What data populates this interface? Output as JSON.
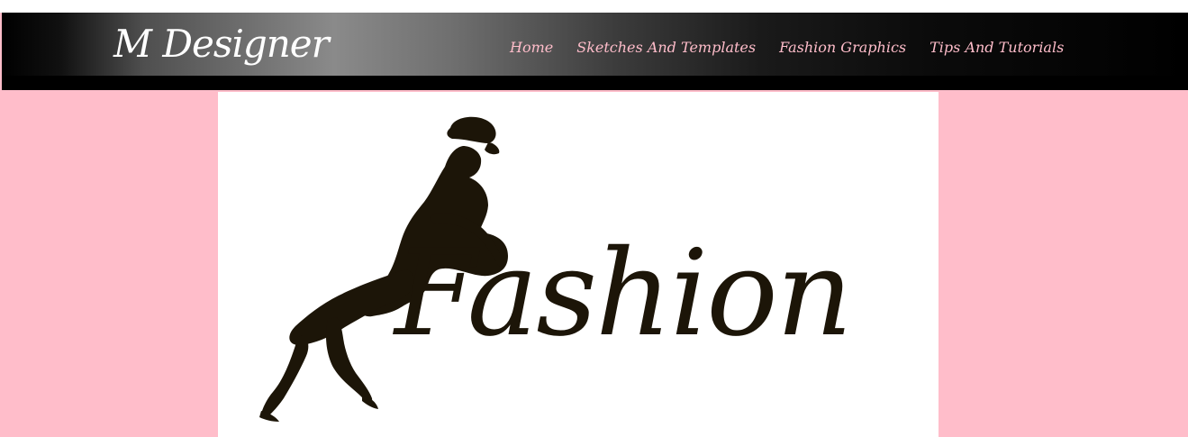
{
  "header": {
    "brand": "M Designer",
    "nav": [
      {
        "label": "Home"
      },
      {
        "label": "Sketches And Templates"
      },
      {
        "label": "Fashion Graphics"
      },
      {
        "label": "Tips And Tutorials"
      }
    ]
  },
  "hero": {
    "word": "Fashion"
  },
  "colors": {
    "accent": "#ffbdca",
    "logo_ink": "#1c1508",
    "header": "#000000"
  }
}
